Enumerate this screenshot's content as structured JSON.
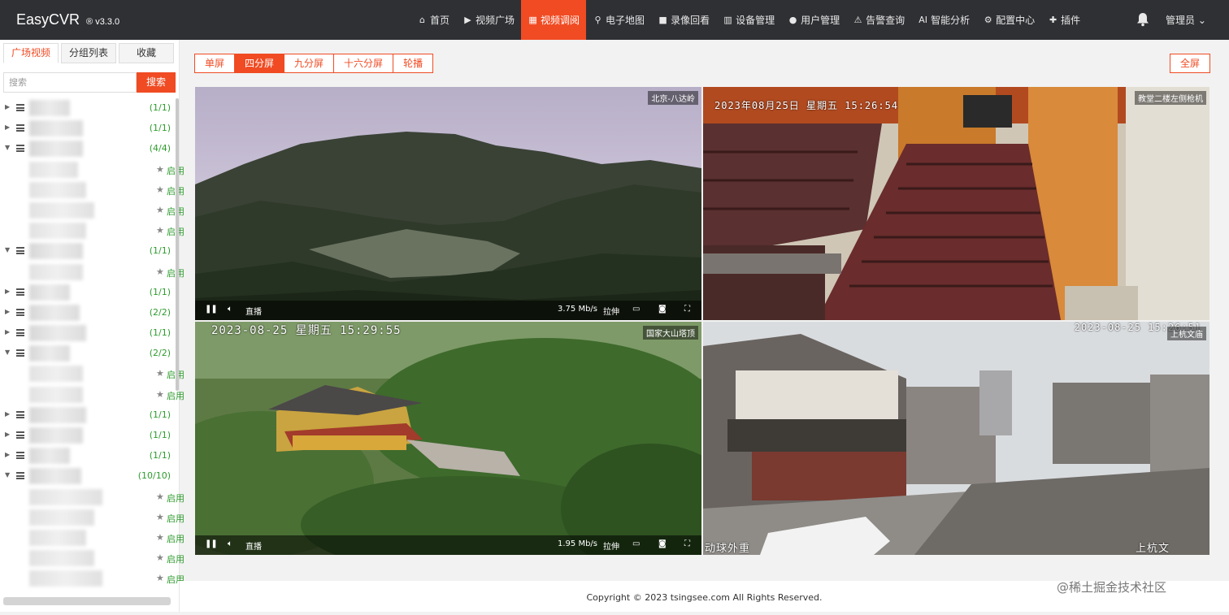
{
  "app": {
    "name": "EasyCVR",
    "version": "® v3.3.0"
  },
  "nav": [
    {
      "label": "首页",
      "icon": "home-icon"
    },
    {
      "label": "视频广场",
      "icon": "play-circle-icon"
    },
    {
      "label": "视频调阅",
      "icon": "grid-icon"
    },
    {
      "label": "电子地图",
      "icon": "map-pin-icon"
    },
    {
      "label": "录像回看",
      "icon": "video-camera-icon"
    },
    {
      "label": "设备管理",
      "icon": "device-icon"
    },
    {
      "label": "用户管理",
      "icon": "user-icon"
    },
    {
      "label": "告警查询",
      "icon": "alarm-icon"
    },
    {
      "label": "智能分析",
      "icon": "ai-icon"
    },
    {
      "label": "配置中心",
      "icon": "gear-icon"
    },
    {
      "label": "插件",
      "icon": "puzzle-icon"
    }
  ],
  "nav_active": "视频调阅",
  "user_menu": "管理员 ⌄",
  "sidebar": {
    "tabs": [
      "广场视频",
      "分组列表",
      "收藏"
    ],
    "search": {
      "placeholder": "搜索",
      "button": "搜索"
    },
    "tree": [
      {
        "type": "group",
        "count": "(1/1)",
        "expanded": false
      },
      {
        "type": "group",
        "count": "(1/1)",
        "expanded": false
      },
      {
        "type": "group",
        "count": "(4/4)",
        "expanded": true
      },
      {
        "type": "channel",
        "status": "启用"
      },
      {
        "type": "channel",
        "status": "启用"
      },
      {
        "type": "channel",
        "status": "启用"
      },
      {
        "type": "channel",
        "status": "启用"
      },
      {
        "type": "group",
        "count": "(1/1)",
        "expanded": true
      },
      {
        "type": "channel",
        "status": "启用"
      },
      {
        "type": "group",
        "count": "(1/1)",
        "expanded": false
      },
      {
        "type": "group",
        "count": "(2/2)",
        "expanded": false
      },
      {
        "type": "group",
        "count": "(1/1)",
        "expanded": false
      },
      {
        "type": "group",
        "count": "(2/2)",
        "expanded": true
      },
      {
        "type": "channel",
        "status": "启用"
      },
      {
        "type": "channel",
        "status": "启用"
      },
      {
        "type": "group",
        "count": "(1/1)",
        "expanded": false
      },
      {
        "type": "group",
        "count": "(1/1)",
        "expanded": false
      },
      {
        "type": "group",
        "count": "(1/1)",
        "expanded": false
      },
      {
        "type": "group",
        "count": "(10/10)",
        "expanded": true
      },
      {
        "type": "channel",
        "status": "启用"
      },
      {
        "type": "channel",
        "status": "启用"
      },
      {
        "type": "channel",
        "status": "启用"
      },
      {
        "type": "channel",
        "status": "启用"
      },
      {
        "type": "channel",
        "status": "启用"
      }
    ]
  },
  "layout_buttons": [
    "单屏",
    "四分屏",
    "九分屏",
    "十六分屏",
    "轮播"
  ],
  "layout_active": "四分屏",
  "fullscreen_label": "全屏",
  "players": [
    {
      "name": "北京-八达岭",
      "osd": "",
      "rate": "3.75 Mb/s",
      "live": "直播",
      "stretch": "拉伸"
    },
    {
      "name": "教堂二楼左侧枪机",
      "osd": "2023年08月25日  星期五  15:26:54",
      "rate": "",
      "live": "",
      "stretch": ""
    },
    {
      "name": "国家大山塔顶",
      "osd": "2023-08-25  星期五  15:29:55",
      "rate": "1.95 Mb/s",
      "live": "直播",
      "stretch": "拉伸"
    },
    {
      "name": "上杭文庙",
      "osd": "2023-08-25  15:26:51",
      "osd_bottom_left": "动球外重",
      "osd_bottom_right": "上杭文",
      "rate": "",
      "live": "",
      "stretch": ""
    }
  ],
  "footer": "Copyright © 2023 tsingsee.com All Rights Reserved.",
  "corner_watermark": "@稀土掘金技术社区",
  "colors": {
    "accent": "#f04b23",
    "topbar": "#2f3034",
    "count_green": "#2e9b2e"
  }
}
